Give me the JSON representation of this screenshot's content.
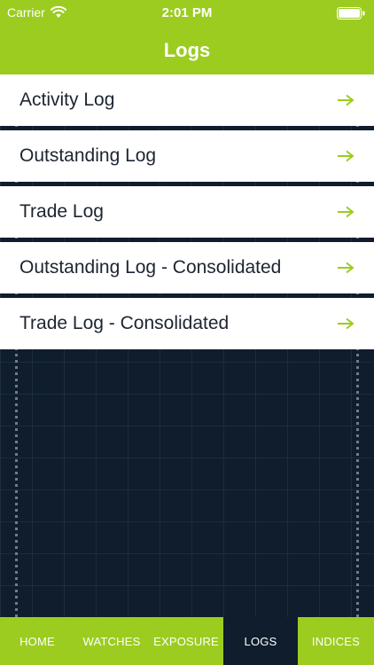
{
  "status_bar": {
    "carrier": "Carrier",
    "time": "2:01 PM"
  },
  "header": {
    "title": "Logs"
  },
  "colors": {
    "accent": "#9ccc1f",
    "background": "#0f1d2d",
    "row_background": "#ffffff",
    "row_text": "#1d2530"
  },
  "logs": {
    "items": [
      {
        "label": "Activity Log",
        "icon": "arrow-right-icon"
      },
      {
        "label": "Outstanding Log",
        "icon": "arrow-right-icon"
      },
      {
        "label": "Trade Log",
        "icon": "arrow-right-icon"
      },
      {
        "label": "Outstanding Log - Consolidated",
        "icon": "arrow-right-icon"
      },
      {
        "label": "Trade Log - Consolidated",
        "icon": "arrow-right-icon"
      }
    ]
  },
  "tabbar": {
    "tabs": [
      {
        "label": "HOME",
        "active": false
      },
      {
        "label": "WATCHES",
        "active": false
      },
      {
        "label": "EXPOSURE",
        "active": false
      },
      {
        "label": "LOGS",
        "active": true
      },
      {
        "label": "INDICES",
        "active": false
      }
    ]
  }
}
